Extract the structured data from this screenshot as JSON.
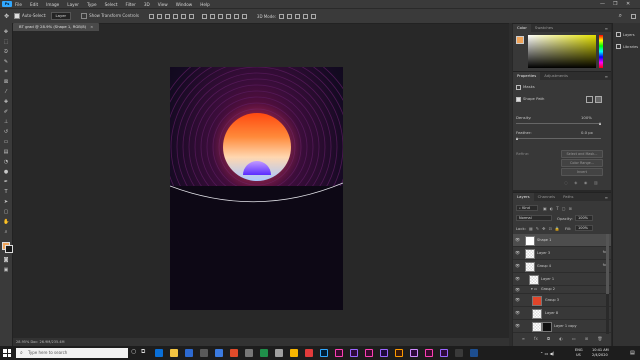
{
  "menu": {
    "logo": "Ps",
    "items": [
      "File",
      "Edit",
      "Image",
      "Layer",
      "Type",
      "Select",
      "Filter",
      "3D",
      "View",
      "Window",
      "Help"
    ],
    "window_controls": [
      "—",
      "❐",
      "✕"
    ]
  },
  "options": {
    "auto_select_label": "Auto-Select:",
    "auto_select_value": "Layer",
    "show_transform_label": "Show Transform Controls",
    "mode_3d": "3D Mode:"
  },
  "document": {
    "tab_title": "BT grad @ 28.9% (Shape 1, RGB/8)",
    "tab_close": "×",
    "status": "28.95%   Doc: 26.9M/235.4M"
  },
  "swatches_panel": {
    "tabs": [
      "Color",
      "Swatches"
    ]
  },
  "properties_panel": {
    "tabs": [
      "Properties",
      "Adjustments"
    ],
    "section": "Masks",
    "mask_type": "Shape Path",
    "density_label": "Density:",
    "density_value": "100%",
    "feather_label": "Feather:",
    "feather_value": "0.0 px",
    "refine_label": "Refine:",
    "buttons": [
      "Select and Mask...",
      "Color Range...",
      "Invert"
    ]
  },
  "layers_panel": {
    "tabs": [
      "Layers",
      "Channels",
      "Paths"
    ],
    "filter_label": "Kind",
    "blend_mode": "Normal",
    "opacity_label": "Opacity:",
    "opacity_value": "100%",
    "lock_label": "Lock:",
    "fill_label": "Fill:",
    "fill_value": "100%",
    "layers": [
      {
        "name": "Shape 1",
        "selected": true,
        "fx": ""
      },
      {
        "name": "Layer 3",
        "selected": false,
        "fx": "fx"
      },
      {
        "name": "Group 4",
        "selected": false,
        "fx": "fx"
      },
      {
        "name": "Layer 1",
        "selected": false,
        "fx": ""
      },
      {
        "name": "Group 2",
        "selected": false,
        "fx": ""
      },
      {
        "name": "Group 3",
        "selected": false,
        "fx": ""
      },
      {
        "name": "Layer 8",
        "selected": false,
        "fx": ""
      },
      {
        "name": "Layer 1 copy",
        "selected": false,
        "fx": ""
      }
    ]
  },
  "dock": {
    "items": [
      "Layers",
      "Libraries"
    ]
  },
  "taskbar": {
    "search_placeholder": "Type here to search",
    "language": "ENG",
    "locale": "US",
    "time": "10:41 AM",
    "date": "2/4/2020"
  },
  "colors": {
    "accent": "#31a8ff",
    "selected_layer": "#4d4d4d"
  }
}
